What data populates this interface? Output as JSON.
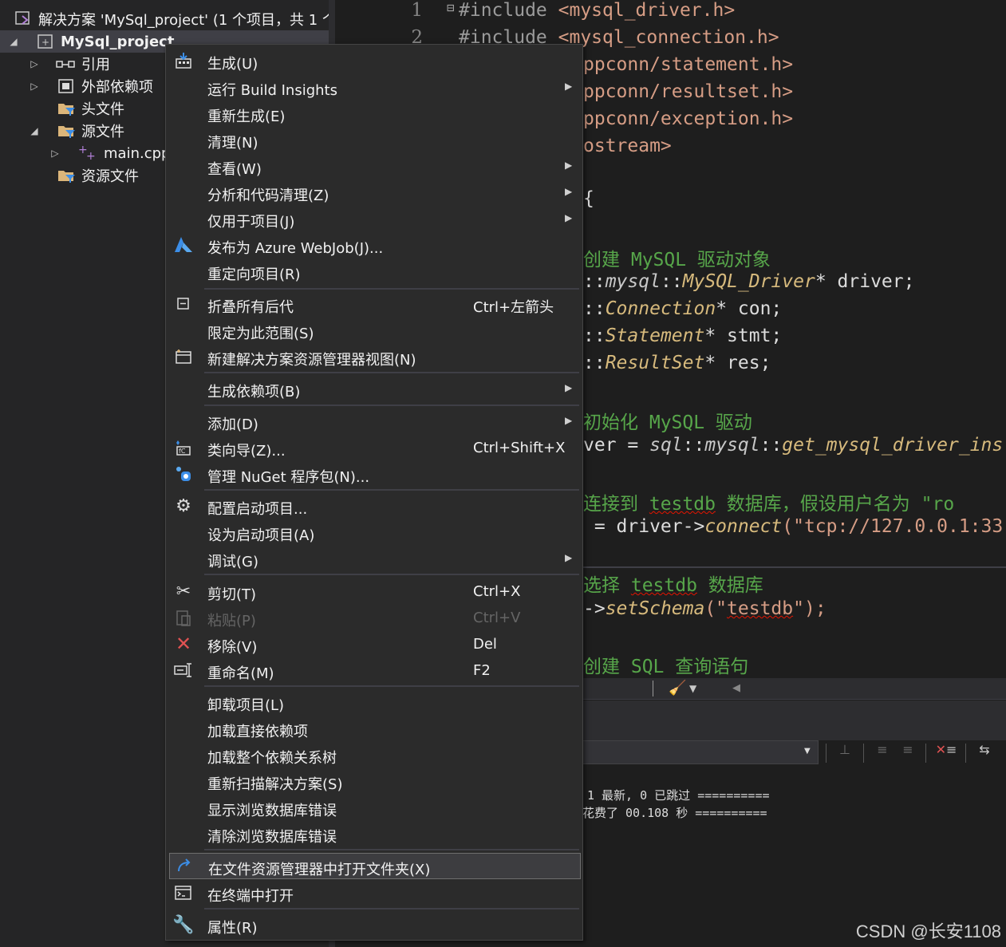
{
  "solution_explorer": {
    "solution_label": "解决方案 'MySql_project' (1 个项目，共 1 个",
    "project_label": "MySql_project",
    "items": [
      {
        "label": "引用"
      },
      {
        "label": "外部依赖项"
      },
      {
        "label": "头文件"
      },
      {
        "label": "源文件"
      },
      {
        "label": "main.cpp"
      },
      {
        "label": "资源文件"
      }
    ]
  },
  "editor": {
    "line_numbers": [
      "1",
      "2"
    ],
    "lines": [
      {
        "kw": "#include",
        "rest": " <mysql_driver.h>"
      },
      {
        "kw": "#include",
        "rest": " <mysql_connection.h>"
      },
      {
        "rest": "ppconn/statement.h>"
      },
      {
        "rest": "ppconn/resultset.h>"
      },
      {
        "rest": "ppconn/exception.h>"
      },
      {
        "rest": "ostream>"
      },
      {
        "rest": "{"
      },
      {
        "cmt": "创建 MySQL 驱动对象"
      },
      {
        "a": "::",
        "b": "mysql",
        "c": "::",
        "d": "MySQL_Driver",
        "e": "* driver;"
      },
      {
        "a": "::",
        "d": "Connection",
        "e": "* con;"
      },
      {
        "a": "::",
        "d": "Statement",
        "e": "* stmt;"
      },
      {
        "a": "::",
        "d": "ResultSet",
        "e": "* res;"
      },
      {
        "cmt": "初始化 MySQL 驱动"
      },
      {
        "a": "ver = ",
        "b": "sql",
        "c": "::",
        "b2": "mysql",
        "c2": "::",
        "f": "get_mysql_driver_ins"
      },
      {
        "cmt_a": "连接到 ",
        "cmt_sq": "testdb",
        "cmt_b": " 数据库，假设用户名为 \"ro"
      },
      {
        "a": " = driver->",
        "f": "connect",
        "e": "(\"tcp://127.0.0.1:33"
      },
      {
        "cmt_a": "选择 ",
        "cmt_sq": "testdb",
        "cmt_b": " 数据库"
      },
      {
        "a": "->",
        "f": "setSchema",
        "e": "(\"",
        "sq": "testdb",
        "e2": "\");"
      },
      {
        "cmt": "创建 SQL 查询语句"
      }
    ]
  },
  "output": {
    "line1": "1 最新, 0 已跳过 ==========",
    "line2": "花费了 00.108 秒 =========="
  },
  "context_menu": {
    "items": [
      {
        "label": "生成(U)",
        "icon": "build-icon"
      },
      {
        "label": "运行 Build Insights",
        "submenu": true
      },
      {
        "label": "重新生成(E)"
      },
      {
        "label": "清理(N)"
      },
      {
        "label": "查看(W)",
        "submenu": true
      },
      {
        "label": "分析和代码清理(Z)",
        "submenu": true
      },
      {
        "label": "仅用于项目(J)",
        "submenu": true
      },
      {
        "label": "发布为 Azure WebJob(J)...",
        "icon": "azure-icon"
      },
      {
        "label": "重定向项目(R)"
      },
      {
        "label": "折叠所有后代",
        "shortcut": "Ctrl+左箭头",
        "icon": "collapse-icon"
      },
      {
        "label": "限定为此范围(S)"
      },
      {
        "label": "新建解决方案资源管理器视图(N)",
        "icon": "new-view-icon"
      },
      {
        "label": "生成依赖项(B)",
        "submenu": true
      },
      {
        "label": "添加(D)",
        "submenu": true
      },
      {
        "label": "类向导(Z)...",
        "shortcut": "Ctrl+Shift+X",
        "icon": "class-wizard-icon"
      },
      {
        "label": "管理 NuGet 程序包(N)...",
        "icon": "nuget-icon"
      },
      {
        "label": "配置启动项目...",
        "icon": "gear-icon"
      },
      {
        "label": "设为启动项目(A)"
      },
      {
        "label": "调试(G)",
        "submenu": true
      },
      {
        "label": "剪切(T)",
        "shortcut": "Ctrl+X",
        "icon": "scissors-icon"
      },
      {
        "label": "粘贴(P)",
        "shortcut": "Ctrl+V",
        "icon": "paste-icon",
        "disabled": true
      },
      {
        "label": "移除(V)",
        "shortcut": "Del",
        "icon": "remove-icon"
      },
      {
        "label": "重命名(M)",
        "shortcut": "F2",
        "icon": "rename-icon"
      },
      {
        "label": "卸载项目(L)"
      },
      {
        "label": "加载直接依赖项"
      },
      {
        "label": "加载整个依赖关系树"
      },
      {
        "label": "重新扫描解决方案(S)"
      },
      {
        "label": "显示浏览数据库错误"
      },
      {
        "label": "清除浏览数据库错误"
      },
      {
        "label": "在文件资源管理器中打开文件夹(X)",
        "icon": "open-folder-icon",
        "highlighted": true
      },
      {
        "label": "在终端中打开",
        "icon": "terminal-icon"
      },
      {
        "label": "属性(R)",
        "icon": "wrench-icon"
      }
    ]
  },
  "watermark": "CSDN @长安1108",
  "colors": {
    "background": "#1e1e1e",
    "menu_background": "#2b2b2b",
    "comment": "#57a64a",
    "type": "#d7ba7d",
    "string": "#d69d85",
    "error_squiggle": "#e51400",
    "remove_red": "#e05252",
    "accent_blue": "#3c8ee7"
  }
}
